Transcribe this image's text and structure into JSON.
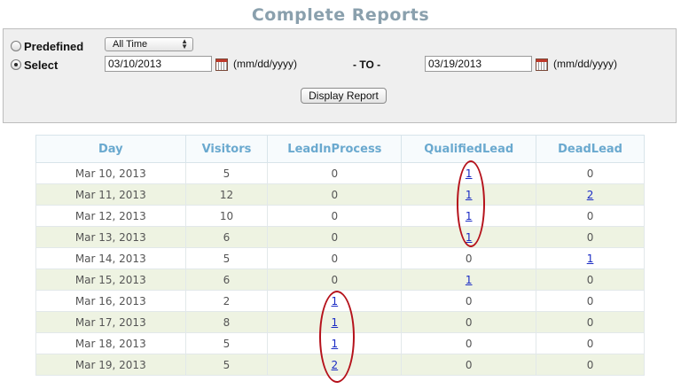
{
  "title": "Complete Reports",
  "filter": {
    "predefined_label": "Predefined",
    "select_label": "Select",
    "predefined_value": "All Time",
    "from_date": "03/10/2013",
    "to_date": "03/19/2013",
    "date_format": "(mm/dd/yyyy)",
    "to_label": "- TO -",
    "display_button": "Display Report",
    "selected": "select"
  },
  "table": {
    "headers": [
      "Day",
      "Visitors",
      "LeadInProcess",
      "QualifiedLead",
      "DeadLead"
    ],
    "rows": [
      {
        "day": "Mar 10, 2013",
        "visitors": "5",
        "lead_in_process": "0",
        "qualified_lead": "1",
        "dead_lead": "0"
      },
      {
        "day": "Mar 11, 2013",
        "visitors": "12",
        "lead_in_process": "0",
        "qualified_lead": "1",
        "dead_lead": "2"
      },
      {
        "day": "Mar 12, 2013",
        "visitors": "10",
        "lead_in_process": "0",
        "qualified_lead": "1",
        "dead_lead": "0"
      },
      {
        "day": "Mar 13, 2013",
        "visitors": "6",
        "lead_in_process": "0",
        "qualified_lead": "1",
        "dead_lead": "0"
      },
      {
        "day": "Mar 14, 2013",
        "visitors": "5",
        "lead_in_process": "0",
        "qualified_lead": "0",
        "dead_lead": "1"
      },
      {
        "day": "Mar 15, 2013",
        "visitors": "6",
        "lead_in_process": "0",
        "qualified_lead": "1",
        "dead_lead": "0"
      },
      {
        "day": "Mar 16, 2013",
        "visitors": "2",
        "lead_in_process": "1",
        "qualified_lead": "0",
        "dead_lead": "0"
      },
      {
        "day": "Mar 17, 2013",
        "visitors": "8",
        "lead_in_process": "1",
        "qualified_lead": "0",
        "dead_lead": "0"
      },
      {
        "day": "Mar 18, 2013",
        "visitors": "5",
        "lead_in_process": "1",
        "qualified_lead": "0",
        "dead_lead": "0"
      },
      {
        "day": "Mar 19, 2013",
        "visitors": "5",
        "lead_in_process": "2",
        "qualified_lead": "0",
        "dead_lead": "0"
      }
    ]
  },
  "colors": {
    "title": "#8aa0ad",
    "header_text": "#6aa9cf",
    "alt_row": "#eef3e2",
    "link": "#1a2bc4",
    "annotation": "#b5121b"
  },
  "icons": [
    "calendar-icon",
    "radio-button",
    "dropdown-arrow-icon"
  ]
}
